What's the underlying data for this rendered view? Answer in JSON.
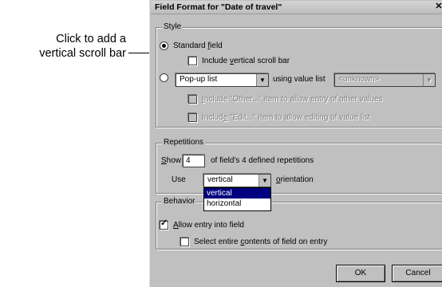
{
  "callout": {
    "line1": "Click to add a",
    "line2": "vertical scroll bar"
  },
  "dialog": {
    "title": "Field Format  for \"Date of travel\"",
    "close_icon": "close-icon"
  },
  "style_group": {
    "legend": "Style",
    "standard_field": "Standard field",
    "include_vertical": "Include vertical scroll bar",
    "popup_list": "Pop-up list",
    "using_value_list": "using value list",
    "value_list_placeholder": "<unknown>",
    "include_other": "Include \"Other...\" item to allow entry of other values",
    "include_edit": "Include \"Edit...\" item to allow editing of value list"
  },
  "repetitions_group": {
    "legend": "Repetitions",
    "show_label": "Show",
    "show_value": "4",
    "defined_text": "of field's 4 defined repetitions",
    "use_label": "Use",
    "orientation_value": "vertical",
    "orientation_label": "orientation",
    "options": [
      "vertical",
      "horizontal"
    ]
  },
  "behavior_group": {
    "legend": "Behavior",
    "allow_entry": "Allow entry into field",
    "select_entire": "Select entire contents of field on entry"
  },
  "buttons": {
    "ok": "OK",
    "cancel": "Cancel"
  }
}
